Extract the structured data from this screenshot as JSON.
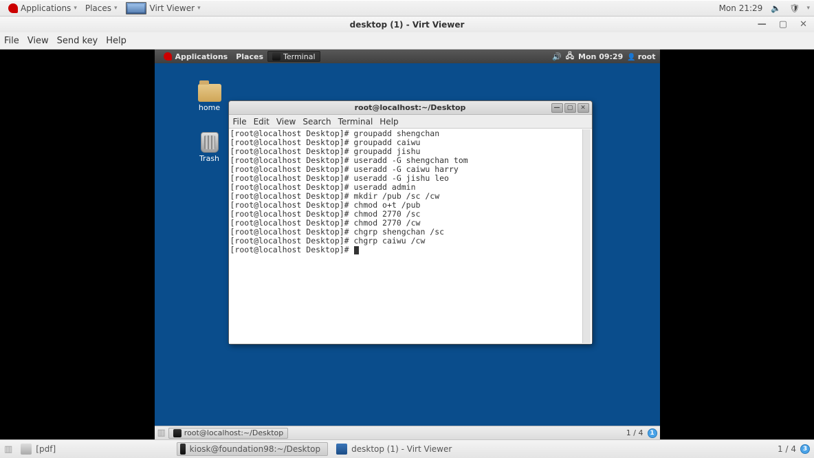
{
  "host_panel": {
    "applications": "Applications",
    "places": "Places",
    "app_task": "Virt Viewer",
    "clock": "Mon 21:29"
  },
  "virt": {
    "title": "desktop (1) - Virt Viewer",
    "menu": {
      "file": "File",
      "view": "View",
      "sendkey": "Send key",
      "help": "Help"
    }
  },
  "guest_panel": {
    "applications": "Applications",
    "places": "Places",
    "task": "Terminal",
    "clock": "Mon 09:29",
    "user": "root"
  },
  "desktop_icons": {
    "home": "home",
    "trash": "Trash"
  },
  "terminal": {
    "title": "root@localhost:~/Desktop",
    "menu": {
      "file": "File",
      "edit": "Edit",
      "view": "View",
      "search": "Search",
      "terminal": "Terminal",
      "help": "Help"
    },
    "lines": [
      "[root@localhost Desktop]# groupadd shengchan",
      "[root@localhost Desktop]# groupadd caiwu",
      "[root@localhost Desktop]# groupadd jishu",
      "[root@localhost Desktop]# useradd -G shengchan tom",
      "[root@localhost Desktop]# useradd -G caiwu harry",
      "[root@localhost Desktop]# useradd -G jishu leo",
      "[root@localhost Desktop]# useradd admin",
      "[root@localhost Desktop]# mkdir /pub /sc /cw",
      "[root@localhost Desktop]# chmod o+t /pub",
      "[root@localhost Desktop]# chmod 2770 /sc",
      "[root@localhost Desktop]# chmod 2770 /cw",
      "[root@localhost Desktop]# chgrp shengchan /sc",
      "[root@localhost Desktop]# chgrp caiwu /cw",
      "[root@localhost Desktop]# "
    ]
  },
  "guest_bottom": {
    "task": "root@localhost:~/Desktop",
    "ws_text": "1 / 4",
    "ws_badge": "1"
  },
  "host_bottom": {
    "pdf": "[pdf]",
    "task1": "kiosk@foundation98:~/Desktop",
    "task2": "desktop (1) - Virt Viewer",
    "ws_text": "1 / 4",
    "ws_badge": "3"
  }
}
